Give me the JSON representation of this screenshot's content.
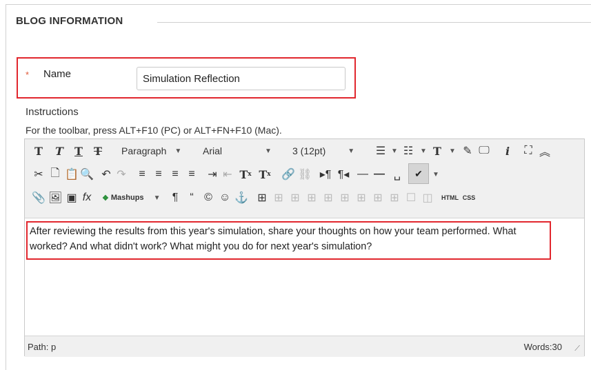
{
  "section": {
    "title": "BLOG INFORMATION"
  },
  "name_field": {
    "required_mark": "*",
    "label": "Name",
    "value": "Simulation Reflection"
  },
  "instructions": {
    "label": "Instructions",
    "hint": "For the toolbar, press ALT+F10 (PC) or ALT+FN+F10 (Mac)."
  },
  "toolbar": {
    "row1": {
      "bold": "T",
      "italic": "T",
      "underline": "T",
      "strike": "T",
      "format_select": "Paragraph",
      "font_select": "Arial",
      "size_select": "3 (12pt)",
      "info": "i"
    },
    "row2": {
      "superscript": "T",
      "subscript": "T"
    },
    "row3": {
      "math": "fx",
      "mashups": "Mashups",
      "pilcrow": "¶",
      "quote": "“",
      "html": "HTML",
      "css": "CSS"
    }
  },
  "content": {
    "text": "After reviewing the results from this year's simulation, share your thoughts on how your team performed. What worked? And what didn't work? What might you do for next year's simulation?"
  },
  "status": {
    "path": "Path: p",
    "words": "Words:30"
  },
  "colors": {
    "highlight": "#e1262d",
    "toolbar_bg": "#f0f0f0"
  }
}
